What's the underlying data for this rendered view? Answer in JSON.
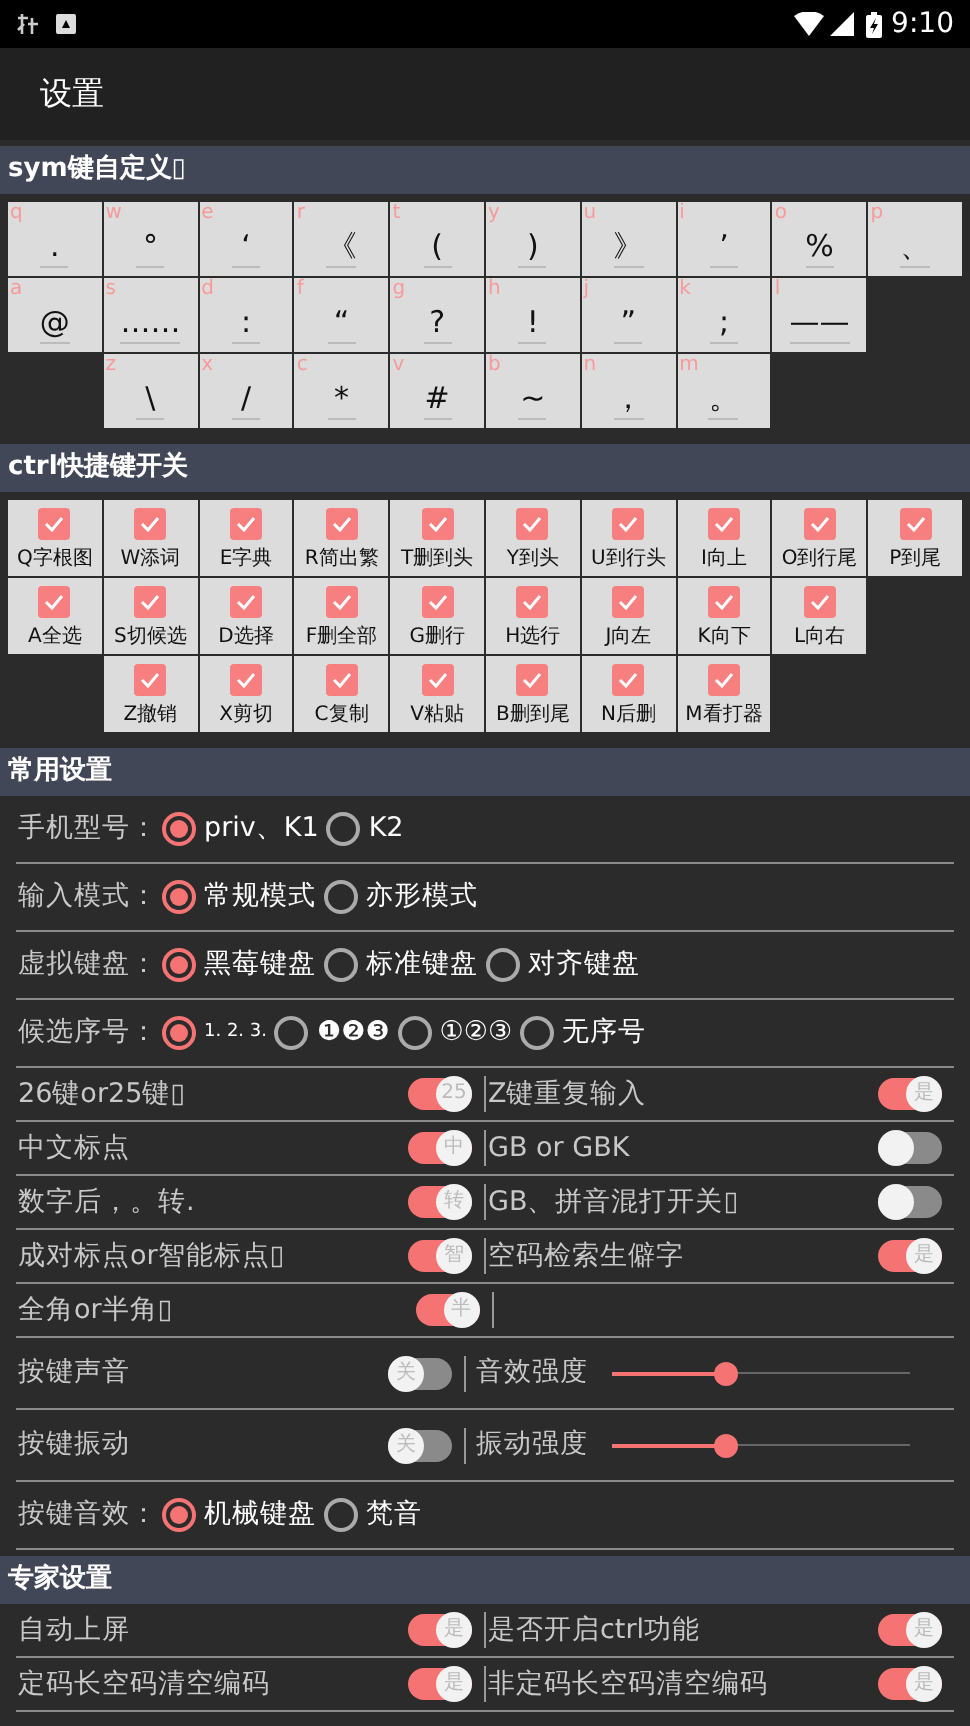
{
  "status_bar": {
    "time": "9:10"
  },
  "app_bar": {
    "title": "设置"
  },
  "sections": [
    {
      "kind": "sym_keys",
      "title": "sym键自定义▯",
      "rows": [
        [
          {
            "letter": "q",
            "symbol": "."
          },
          {
            "letter": "w",
            "symbol": "°"
          },
          {
            "letter": "e",
            "symbol": "‘"
          },
          {
            "letter": "r",
            "symbol": "《"
          },
          {
            "letter": "t",
            "symbol": "("
          },
          {
            "letter": "y",
            "symbol": ")"
          },
          {
            "letter": "u",
            "symbol": "》"
          },
          {
            "letter": "i",
            "symbol": "’"
          },
          {
            "letter": "o",
            "symbol": "%"
          },
          {
            "letter": "p",
            "symbol": "、"
          }
        ],
        [
          {
            "letter": "a",
            "symbol": "@"
          },
          {
            "letter": "s",
            "symbol": "……"
          },
          {
            "letter": "d",
            "symbol": ":"
          },
          {
            "letter": "f",
            "symbol": "“"
          },
          {
            "letter": "g",
            "symbol": "?"
          },
          {
            "letter": "h",
            "symbol": "!"
          },
          {
            "letter": "j",
            "symbol": "”"
          },
          {
            "letter": "k",
            "symbol": ";"
          },
          {
            "letter": "l",
            "symbol": "——"
          }
        ],
        [
          "",
          {
            "letter": "z",
            "symbol": "\\"
          },
          {
            "letter": "x",
            "symbol": "/"
          },
          {
            "letter": "c",
            "symbol": "*"
          },
          {
            "letter": "v",
            "symbol": "#"
          },
          {
            "letter": "b",
            "symbol": "~"
          },
          {
            "letter": "n",
            "symbol": "，"
          },
          {
            "letter": "m",
            "symbol": "。"
          }
        ]
      ]
    },
    {
      "kind": "ctrl_keys",
      "title": "ctrl快捷键开关",
      "rows": [
        [
          {
            "label": "Q字根图",
            "checked": true
          },
          {
            "label": "W添词",
            "checked": true
          },
          {
            "label": "E字典",
            "checked": true
          },
          {
            "label": "R简出繁",
            "checked": true
          },
          {
            "label": "T删到头",
            "checked": true
          },
          {
            "label": "Y到头",
            "checked": true
          },
          {
            "label": "U到行头",
            "checked": true
          },
          {
            "label": "I向上",
            "checked": true
          },
          {
            "label": "O到行尾",
            "checked": true
          },
          {
            "label": "P到尾",
            "checked": true
          }
        ],
        [
          {
            "label": "A全选",
            "checked": true
          },
          {
            "label": "S切候选",
            "checked": true
          },
          {
            "label": "D选择",
            "checked": true
          },
          {
            "label": "F删全部",
            "checked": true
          },
          {
            "label": "G删行",
            "checked": true
          },
          {
            "label": "H选行",
            "checked": true
          },
          {
            "label": "J向左",
            "checked": true
          },
          {
            "label": "K向下",
            "checked": true
          },
          {
            "label": "L向右",
            "checked": true
          }
        ],
        [
          "",
          {
            "label": "Z撤销",
            "checked": true
          },
          {
            "label": "X剪切",
            "checked": true
          },
          {
            "label": "C复制",
            "checked": true
          },
          {
            "label": "V粘贴",
            "checked": true
          },
          {
            "label": "B删到尾",
            "checked": true
          },
          {
            "label": "N后删",
            "checked": true
          },
          {
            "label": "M看打器",
            "checked": true
          }
        ]
      ]
    },
    {
      "kind": "settings",
      "title": "常用设置",
      "items": [
        {
          "kind": "radio",
          "label": "手机型号：",
          "options": [
            {
              "label": "priv、K1",
              "selected": true
            },
            {
              "label": "K2",
              "selected": false
            }
          ]
        },
        {
          "kind": "radio",
          "label": "输入模式：",
          "options": [
            {
              "label": "常规模式",
              "selected": true
            },
            {
              "label": "亦形模式",
              "selected": false
            }
          ]
        },
        {
          "kind": "radio",
          "label": "虚拟键盘：",
          "options": [
            {
              "label": "黑莓键盘",
              "selected": true
            },
            {
              "label": "标准键盘",
              "selected": false
            },
            {
              "label": "对齐键盘",
              "selected": false
            }
          ]
        },
        {
          "kind": "radio",
          "label": "候选序号：",
          "options": [
            {
              "label": "1. 2. 3.",
              "selected": true
            },
            {
              "label": "❶❷❸",
              "selected": false
            },
            {
              "label": "①②③",
              "selected": false
            },
            {
              "label": "无序号",
              "selected": false
            }
          ]
        },
        {
          "kind": "pair",
          "cells": [
            {
              "kind": "toggle",
              "label": "26键or25键▯",
              "on": true,
              "thumb_text": "25"
            },
            {
              "kind": "toggle",
              "label": "Z键重复输入",
              "on": true,
              "thumb_text": "是"
            }
          ]
        },
        {
          "kind": "pair",
          "cells": [
            {
              "kind": "toggle",
              "label": "中文标点",
              "on": true,
              "thumb_text": "中"
            },
            {
              "kind": "toggle",
              "label": "GB or GBK",
              "on": false
            }
          ]
        },
        {
          "kind": "pair",
          "cells": [
            {
              "kind": "toggle",
              "label": "数字后，。转.",
              "on": true,
              "thumb_text": "转"
            },
            {
              "kind": "toggle",
              "label": "GB、拼音混打开关▯",
              "on": false
            }
          ]
        },
        {
          "kind": "pair",
          "cells": [
            {
              "kind": "toggle",
              "label": "成对标点or智能标点▯",
              "on": true,
              "thumb_text": "智"
            },
            {
              "kind": "toggle",
              "label": "空码检索生僻字",
              "on": true,
              "thumb_text": "是"
            }
          ]
        },
        {
          "kind": "pair",
          "cells": [
            {
              "kind": "toggle",
              "label": "全角or半角▯",
              "on": true,
              "thumb_text": "半"
            },
            {
              "kind": "empty"
            }
          ]
        },
        {
          "kind": "pair",
          "cells": [
            {
              "kind": "toggle",
              "label": "按键声音",
              "on": false,
              "thumb_text": "关"
            },
            {
              "kind": "slider",
              "label": "音效强度",
              "level": 0.38
            }
          ]
        },
        {
          "kind": "pair",
          "cells": [
            {
              "kind": "toggle",
              "label": "按键振动",
              "on": false,
              "thumb_text": "关"
            },
            {
              "kind": "slider",
              "label": "振动强度",
              "level": 0.38
            }
          ]
        },
        {
          "kind": "radio",
          "label": "按键音效：",
          "options": [
            {
              "label": "机械键盘",
              "selected": true
            },
            {
              "label": "梵音",
              "selected": false
            }
          ]
        }
      ]
    },
    {
      "kind": "settings",
      "title": "专家设置",
      "items": [
        {
          "kind": "pair",
          "cells": [
            {
              "kind": "toggle",
              "label": "自动上屏",
              "on": true,
              "thumb_text": "是"
            },
            {
              "kind": "toggle",
              "label": "是否开启ctrl功能",
              "on": true,
              "thumb_text": "是"
            }
          ]
        },
        {
          "kind": "pair",
          "cells": [
            {
              "kind": "toggle",
              "label": "定码长空码清空编码",
              "on": true,
              "thumb_text": "是"
            },
            {
              "kind": "toggle",
              "label": "非定码长空码清空编码",
              "on": true,
              "thumb_text": "是"
            }
          ]
        }
      ]
    }
  ]
}
